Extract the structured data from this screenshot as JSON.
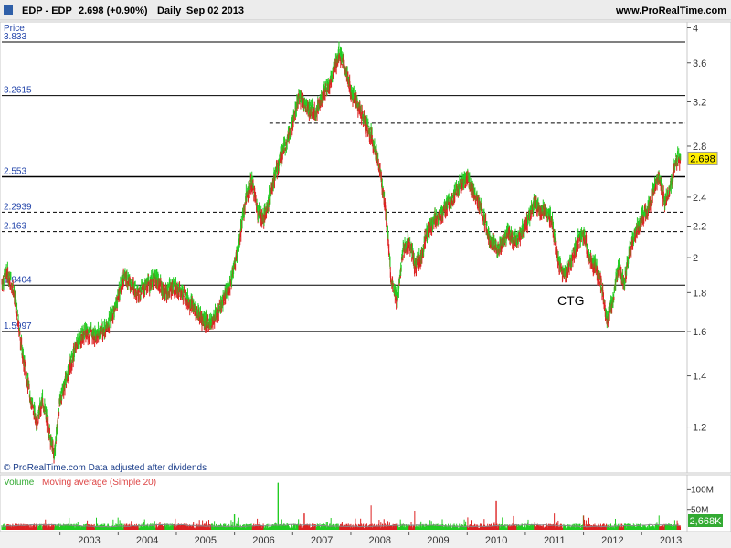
{
  "header": {
    "symbol": "EDP - EDP",
    "price_change": "2.698 (+0.90%)",
    "period": "Daily",
    "date": "Sep 02 2013",
    "brand": "www.ProRealTime.com"
  },
  "price_panel": {
    "axis_title": "Price",
    "credit": "© ProRealTime.com  Data adjusted after dividends",
    "annotation": "CTG",
    "last_price_label": "2.698"
  },
  "volume_panel": {
    "title_volume": "Volume",
    "title_ma": "Moving average (Simple 20)",
    "last_volume_label": "2,668K"
  },
  "colors": {
    "up": "#22cc22",
    "down": "#dd2222",
    "grid": "#000000",
    "axis_text": "#333333",
    "level_text": "#2244aa",
    "price_badge": "#ffee00",
    "volume_badge": "#33aa33",
    "ma_line": "#888888"
  },
  "chart_data": {
    "type": "line",
    "x_ticks": [
      "2003",
      "2004",
      "2005",
      "2006",
      "2007",
      "2008",
      "2009",
      "2010",
      "2011",
      "2012",
      "2013"
    ],
    "y_ticks": [
      1.2,
      1.4,
      1.6,
      1.8,
      2,
      2.2,
      2.4,
      2.8,
      3.2,
      3.6,
      4
    ],
    "y_tick_labels": [
      "1.2",
      "1.4",
      "1.6",
      "1.8",
      "2",
      "2.2",
      "2.4",
      "2.8",
      "3.2",
      "3.6",
      "4"
    ],
    "ylim": [
      1.05,
      4.05
    ],
    "y_scale": "log",
    "x_range": [
      2002.0,
      2013.75
    ],
    "price_series": [
      [
        2002.0,
        1.85
      ],
      [
        2002.08,
        1.92
      ],
      [
        2002.2,
        1.82
      ],
      [
        2002.35,
        1.5
      ],
      [
        2002.5,
        1.3
      ],
      [
        2002.6,
        1.22
      ],
      [
        2002.7,
        1.3
      ],
      [
        2002.8,
        1.2
      ],
      [
        2002.9,
        1.1
      ],
      [
        2003.0,
        1.3
      ],
      [
        2003.15,
        1.42
      ],
      [
        2003.3,
        1.55
      ],
      [
        2003.45,
        1.6
      ],
      [
        2003.6,
        1.58
      ],
      [
        2003.8,
        1.62
      ],
      [
        2003.95,
        1.72
      ],
      [
        2004.1,
        1.9
      ],
      [
        2004.2,
        1.86
      ],
      [
        2004.35,
        1.8
      ],
      [
        2004.5,
        1.84
      ],
      [
        2004.65,
        1.88
      ],
      [
        2004.8,
        1.8
      ],
      [
        2004.95,
        1.83
      ],
      [
        2005.1,
        1.8
      ],
      [
        2005.3,
        1.72
      ],
      [
        2005.45,
        1.66
      ],
      [
        2005.6,
        1.64
      ],
      [
        2005.75,
        1.72
      ],
      [
        2005.9,
        1.82
      ],
      [
        2006.0,
        1.95
      ],
      [
        2006.1,
        2.15
      ],
      [
        2006.2,
        2.4
      ],
      [
        2006.3,
        2.52
      ],
      [
        2006.4,
        2.3
      ],
      [
        2006.5,
        2.25
      ],
      [
        2006.6,
        2.4
      ],
      [
        2006.75,
        2.65
      ],
      [
        2006.9,
        2.85
      ],
      [
        2007.0,
        3.0
      ],
      [
        2007.1,
        3.25
      ],
      [
        2007.25,
        3.15
      ],
      [
        2007.4,
        3.1
      ],
      [
        2007.5,
        3.25
      ],
      [
        2007.65,
        3.4
      ],
      [
        2007.8,
        3.72
      ],
      [
        2007.9,
        3.55
      ],
      [
        2008.0,
        3.3
      ],
      [
        2008.1,
        3.2
      ],
      [
        2008.25,
        3.0
      ],
      [
        2008.35,
        2.9
      ],
      [
        2008.5,
        2.6
      ],
      [
        2008.6,
        2.3
      ],
      [
        2008.7,
        1.85
      ],
      [
        2008.8,
        1.75
      ],
      [
        2008.9,
        2.05
      ],
      [
        2009.0,
        2.1
      ],
      [
        2009.1,
        1.95
      ],
      [
        2009.2,
        2.0
      ],
      [
        2009.3,
        2.15
      ],
      [
        2009.45,
        2.25
      ],
      [
        2009.6,
        2.3
      ],
      [
        2009.75,
        2.4
      ],
      [
        2009.9,
        2.5
      ],
      [
        2010.0,
        2.55
      ],
      [
        2010.1,
        2.45
      ],
      [
        2010.25,
        2.3
      ],
      [
        2010.4,
        2.1
      ],
      [
        2010.55,
        2.05
      ],
      [
        2010.7,
        2.15
      ],
      [
        2010.85,
        2.1
      ],
      [
        2011.0,
        2.2
      ],
      [
        2011.15,
        2.35
      ],
      [
        2011.3,
        2.3
      ],
      [
        2011.45,
        2.25
      ],
      [
        2011.55,
        2.0
      ],
      [
        2011.65,
        1.9
      ],
      [
        2011.75,
        1.95
      ],
      [
        2011.9,
        2.1
      ],
      [
        2012.0,
        2.15
      ],
      [
        2012.1,
        2.0
      ],
      [
        2012.2,
        1.95
      ],
      [
        2012.3,
        1.85
      ],
      [
        2012.4,
        1.65
      ],
      [
        2012.5,
        1.75
      ],
      [
        2012.6,
        1.95
      ],
      [
        2012.7,
        1.85
      ],
      [
        2012.8,
        2.05
      ],
      [
        2012.9,
        2.15
      ],
      [
        2013.0,
        2.25
      ],
      [
        2013.1,
        2.3
      ],
      [
        2013.2,
        2.45
      ],
      [
        2013.3,
        2.55
      ],
      [
        2013.4,
        2.35
      ],
      [
        2013.5,
        2.5
      ],
      [
        2013.6,
        2.7
      ],
      [
        2013.67,
        2.698
      ]
    ],
    "levels": [
      {
        "label": "3.833",
        "value": 3.833,
        "style": "solid"
      },
      {
        "label": "3.2615",
        "value": 3.2615,
        "style": "solid"
      },
      {
        "label": "",
        "value": 3.0,
        "style": "dashed",
        "x_start": 2006.6
      },
      {
        "label": "2.553",
        "value": 2.553,
        "style": "solid"
      },
      {
        "label": "2.2939",
        "value": 2.2939,
        "style": "dashed"
      },
      {
        "label": "2.163",
        "value": 2.163,
        "style": "dashed"
      },
      {
        "label": "1.8404",
        "value": 1.8404,
        "style": "solid"
      },
      {
        "label": "1.5997",
        "value": 1.5997,
        "style": "solid"
      }
    ],
    "volume": {
      "y_ticks": [
        50,
        100
      ],
      "y_tick_labels": [
        "50M",
        "100M"
      ],
      "ylim": [
        0,
        130
      ],
      "spikes": [
        [
          2006.75,
          115
        ],
        [
          2008.35,
          60
        ],
        [
          2010.5,
          72
        ],
        [
          2006.0,
          38
        ],
        [
          2007.2,
          40
        ],
        [
          2009.1,
          45
        ],
        [
          2012.0,
          35
        ],
        [
          2004.0,
          30
        ],
        [
          2011.5,
          40
        ],
        [
          2013.3,
          35
        ]
      ]
    }
  }
}
